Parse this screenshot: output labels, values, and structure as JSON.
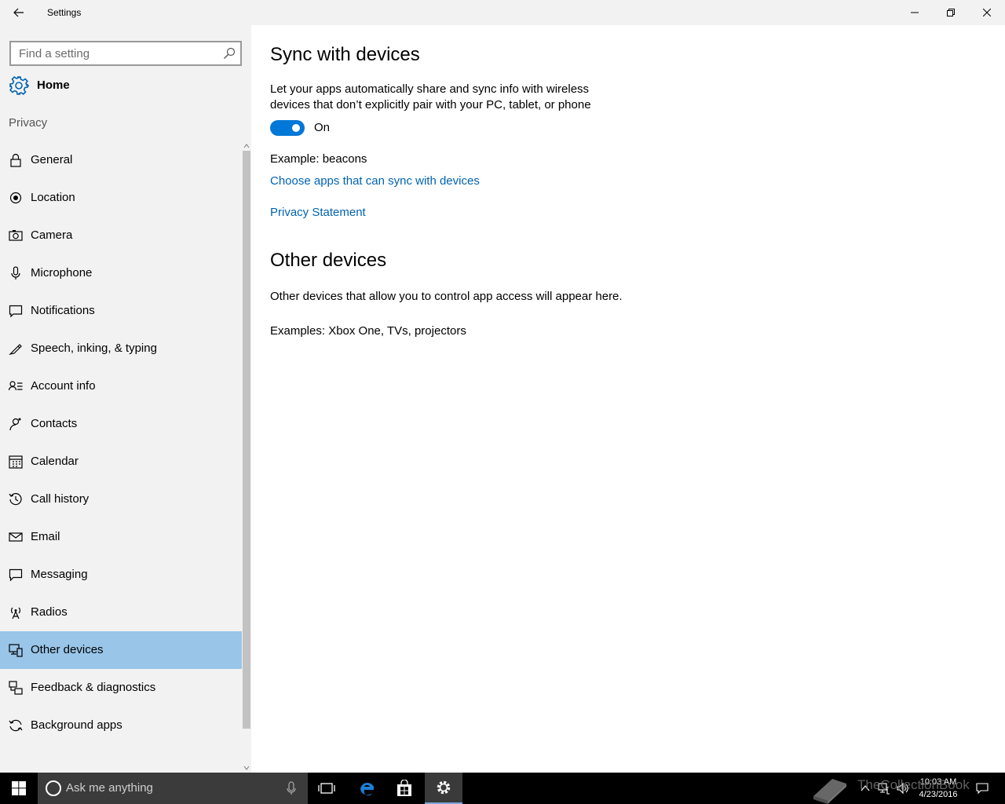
{
  "window": {
    "title": "Settings"
  },
  "sidebar": {
    "search_placeholder": "Find a setting",
    "home_label": "Home",
    "section": "Privacy",
    "items": [
      {
        "label": "General",
        "icon": "lock-icon"
      },
      {
        "label": "Location",
        "icon": "location-icon"
      },
      {
        "label": "Camera",
        "icon": "camera-icon"
      },
      {
        "label": "Microphone",
        "icon": "microphone-icon"
      },
      {
        "label": "Notifications",
        "icon": "notifications-icon"
      },
      {
        "label": "Speech, inking, & typing",
        "icon": "speech-icon"
      },
      {
        "label": "Account info",
        "icon": "account-info-icon"
      },
      {
        "label": "Contacts",
        "icon": "contacts-icon"
      },
      {
        "label": "Calendar",
        "icon": "calendar-icon"
      },
      {
        "label": "Call history",
        "icon": "call-history-icon"
      },
      {
        "label": "Email",
        "icon": "email-icon"
      },
      {
        "label": "Messaging",
        "icon": "messaging-icon"
      },
      {
        "label": "Radios",
        "icon": "radios-icon"
      },
      {
        "label": "Other devices",
        "icon": "other-devices-icon",
        "selected": true
      },
      {
        "label": "Feedback & diagnostics",
        "icon": "feedback-icon"
      },
      {
        "label": "Background apps",
        "icon": "background-apps-icon"
      }
    ]
  },
  "main": {
    "heading": "Sync with devices",
    "description": "Let your apps automatically share and sync info with wireless devices that don’t explicitly pair with your PC, tablet, or phone",
    "toggle_state": "On",
    "example": "Example: beacons",
    "link_choose": "Choose apps that can sync with devices",
    "link_privacy": "Privacy Statement",
    "heading2": "Other devices",
    "other_desc": "Other devices that allow you to control app access will appear here.",
    "other_examples": "Examples: Xbox One, TVs, projectors"
  },
  "taskbar": {
    "search_placeholder": "Ask me anything",
    "time": "10:03 AM",
    "date": "4/23/2016",
    "watermark": "TheCollectionBook"
  },
  "colors": {
    "accent": "#0078d7",
    "link": "#0063b1",
    "selected": "#99c5e8",
    "sidebar_bg": "#f2f2f2"
  }
}
